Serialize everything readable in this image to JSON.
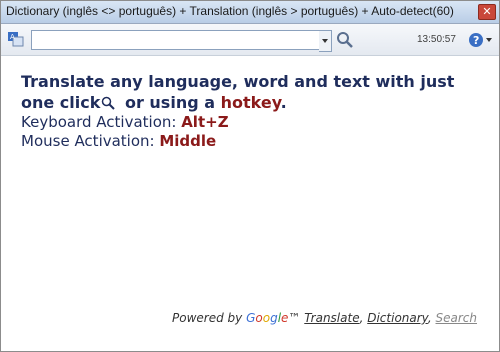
{
  "window": {
    "title": "Dictionary (inglês <> português) + Translation (inglês > português) + Auto-detect(60)"
  },
  "toolbar": {
    "search_value": "",
    "clock": "13:50:57"
  },
  "content": {
    "headline_part1": "Translate any language, word and text with just one click",
    "headline_part2": " or using a ",
    "headline_hotkey": "hotkey",
    "headline_end": ".",
    "keyboard_label": "Keyboard Activation: ",
    "keyboard_value": "Alt+Z",
    "mouse_label": "Mouse Activation: ",
    "mouse_value": "Middle"
  },
  "footer": {
    "powered_by": "Powered by ",
    "google_letters": [
      "G",
      "o",
      "o",
      "g",
      "l",
      "e"
    ],
    "trademark": "™ ",
    "translate_link": "Translate",
    "sep1": ", ",
    "dictionary_link": "Dictionary",
    "sep2": ", ",
    "search_link": "Search"
  },
  "colors": {
    "headline": "#1f2d5c",
    "accent": "#8b1a1a"
  },
  "icons": [
    "app-icon",
    "chevron-down-icon",
    "search-icon",
    "help-icon",
    "close-icon"
  ]
}
